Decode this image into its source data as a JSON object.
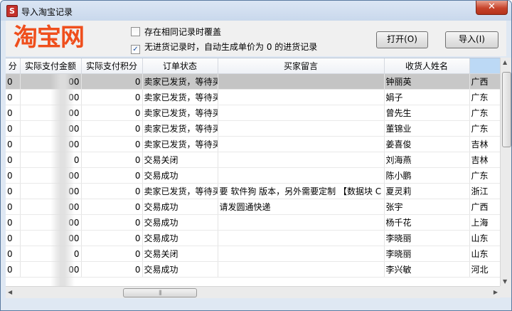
{
  "window": {
    "title": "导入淘宝记录",
    "close_label": "✕"
  },
  "logo": "淘宝网",
  "options": [
    {
      "label": "存在相同记录时覆盖",
      "checked": false
    },
    {
      "label": "无进货记录时，自动生成单价为 0 的进货记录",
      "checked": true
    }
  ],
  "buttons": {
    "open": "打开(O)",
    "import": "导入(I)"
  },
  "table": {
    "columns": [
      "分",
      "实际支付金额",
      "实际支付积分",
      "订单状态",
      "买家留言",
      "收货人姓名",
      ""
    ],
    "rows": [
      {
        "c0": "0",
        "amount": "00",
        "points": "0",
        "status": "卖家已发货，等待买",
        "message": "",
        "name": "钟丽英",
        "region": "广西"
      },
      {
        "c0": "0",
        "amount": "00",
        "points": "0",
        "status": "卖家已发货，等待买",
        "message": "",
        "name": "娟子",
        "region": "广东"
      },
      {
        "c0": "0",
        "amount": "00",
        "points": "0",
        "status": "卖家已发货，等待买",
        "message": "",
        "name": "曾先生",
        "region": "广东"
      },
      {
        "c0": "0",
        "amount": "00",
        "points": "0",
        "status": "卖家已发货，等待买",
        "message": "",
        "name": "董锦业",
        "region": "广东"
      },
      {
        "c0": "0",
        "amount": "00",
        "points": "0",
        "status": "卖家已发货，等待买",
        "message": "",
        "name": "姜喜俊",
        "region": "吉林"
      },
      {
        "c0": "0",
        "amount": "0",
        "points": "0",
        "status": "交易关闭",
        "message": "",
        "name": "刘海燕",
        "region": "吉林"
      },
      {
        "c0": "0",
        "amount": "00",
        "points": "0",
        "status": "交易成功",
        "message": "",
        "name": "陈小鹏",
        "region": "广东"
      },
      {
        "c0": "0",
        "amount": "00",
        "points": "0",
        "status": "卖家已发货，等待买",
        "message": "要 软件狗 版本，另外需要定制 【数据块 C",
        "name": "夏灵莉",
        "region": "浙江"
      },
      {
        "c0": "0",
        "amount": "00",
        "points": "0",
        "status": "交易成功",
        "message": "请发圆通快递",
        "name": "张宇",
        "region": "广西"
      },
      {
        "c0": "0",
        "amount": "00",
        "points": "0",
        "status": "交易成功",
        "message": "",
        "name": "杨千花",
        "region": "上海"
      },
      {
        "c0": "0",
        "amount": "00",
        "points": "0",
        "status": "交易成功",
        "message": "",
        "name": "李晓丽",
        "region": "山东"
      },
      {
        "c0": "0",
        "amount": "0",
        "points": "0",
        "status": "交易关闭",
        "message": "",
        "name": "李晓丽",
        "region": "山东"
      },
      {
        "c0": "0",
        "amount": "00",
        "points": "0",
        "status": "交易成功",
        "message": "",
        "name": "李兴敏",
        "region": "河北"
      }
    ]
  },
  "scrollbar": {
    "grip": "|||"
  },
  "colors": {
    "logo": "#ef4f1d",
    "selected_row": "#c8c8c8",
    "selected_header": "#bcd9f5"
  }
}
